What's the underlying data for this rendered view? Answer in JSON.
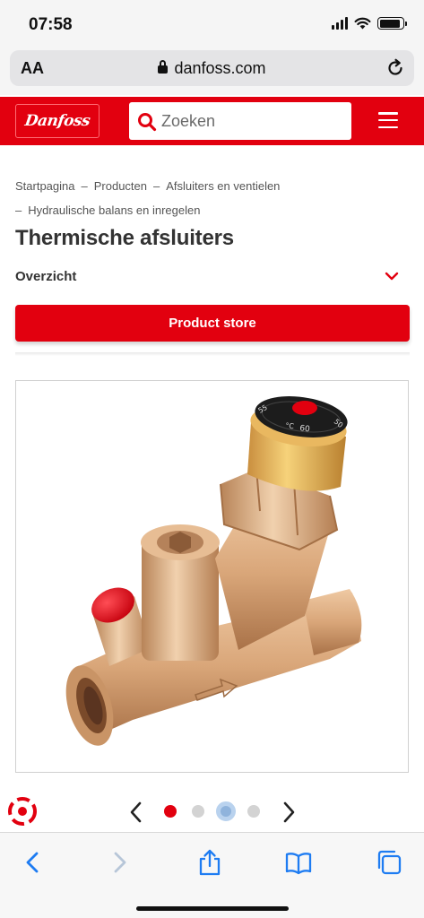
{
  "status_bar": {
    "time": "07:58"
  },
  "browser": {
    "text_size_label": "AA",
    "domain": "danfoss.com"
  },
  "site_header": {
    "logo_text": "Danfoss",
    "search_placeholder": "Zoeken"
  },
  "breadcrumb": {
    "items": [
      "Startpagina",
      "Producten",
      "Afsluiters en ventielen",
      "Hydraulische balans en inregelen"
    ],
    "separator": "–"
  },
  "page": {
    "title": "Thermische afsluiters",
    "overview_label": "Overzicht",
    "store_button_label": "Product store"
  },
  "product_image": {
    "dial_labels": [
      "60",
      "°C",
      "55",
      "50"
    ]
  },
  "carousel": {
    "dot_count": 4,
    "active_index": 0
  },
  "colors": {
    "brand_red": "#e2000f",
    "brass": "#d6a67a",
    "ios_blue": "#1e7cf2"
  },
  "icons": [
    "search-icon",
    "menu-icon",
    "chevron-down-icon",
    "reload-icon",
    "lock-icon",
    "back-icon",
    "forward-icon",
    "share-icon",
    "bookmarks-icon",
    "tabs-icon"
  ]
}
